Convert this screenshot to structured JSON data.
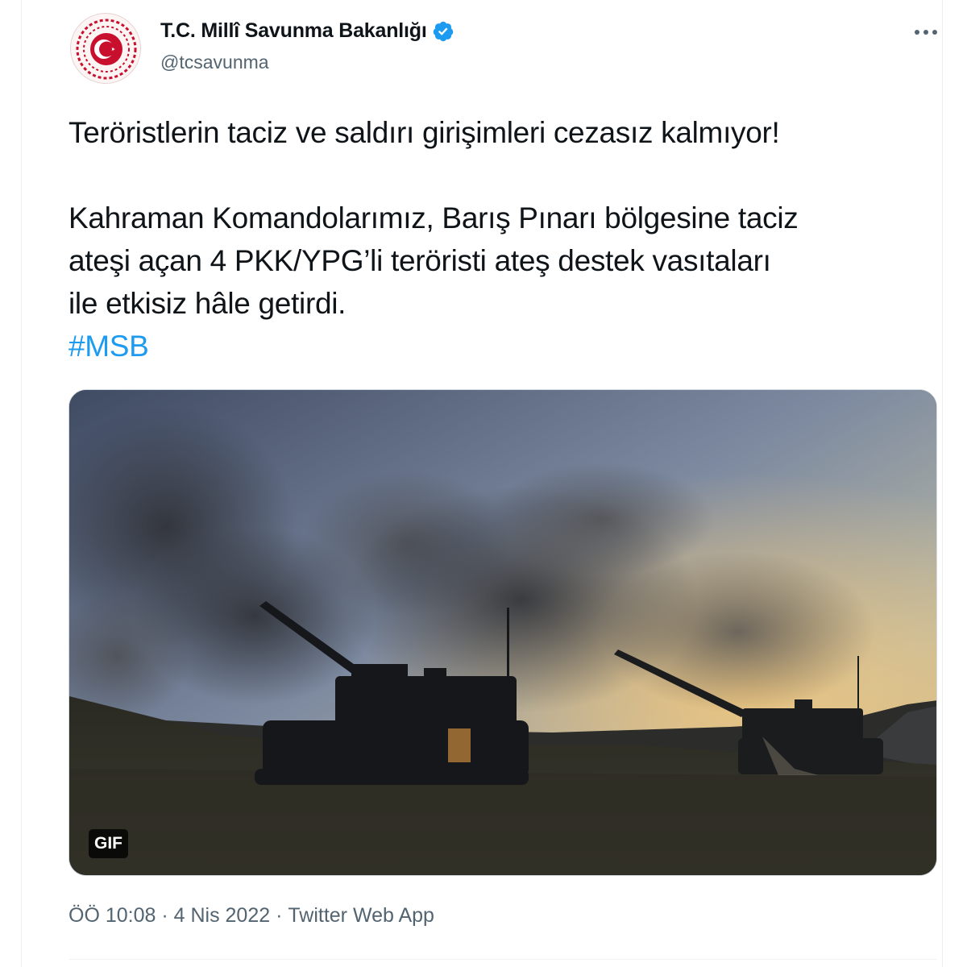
{
  "tweet": {
    "author": {
      "display_name": "T.C. Millî Savunma Bakanlığı",
      "handle": "@tcsavunma",
      "verified": true,
      "avatar_icon": "msb-emblem-icon",
      "avatar_colors": {
        "ring": "#c8102e",
        "background": "#fdf4f4"
      }
    },
    "more_label": "…",
    "text": {
      "line1": "Teröristlerin taciz ve saldırı girişimleri cezasız kalmıyor!",
      "line2": "Kahraman Komandolarımız, Barış Pınarı bölgesine taciz",
      "line3": "ateşi açan 4 PKK/YPG’li teröristi ateş destek vasıtaları",
      "line4": "ile etkisiz hâle getirdi.",
      "hashtag": "#MSB"
    },
    "media": {
      "type": "gif",
      "badge": "GIF",
      "description_icon": "artillery-image"
    },
    "meta": {
      "time": "ÖÖ 10:08",
      "separator1": " · ",
      "date": "4 Nis 2022",
      "separator2": " · ",
      "source": "Twitter Web App"
    },
    "colors": {
      "text": "#0f1419",
      "secondary": "#536471",
      "link": "#1d9bf0",
      "verified": "#1d9bf0"
    }
  }
}
